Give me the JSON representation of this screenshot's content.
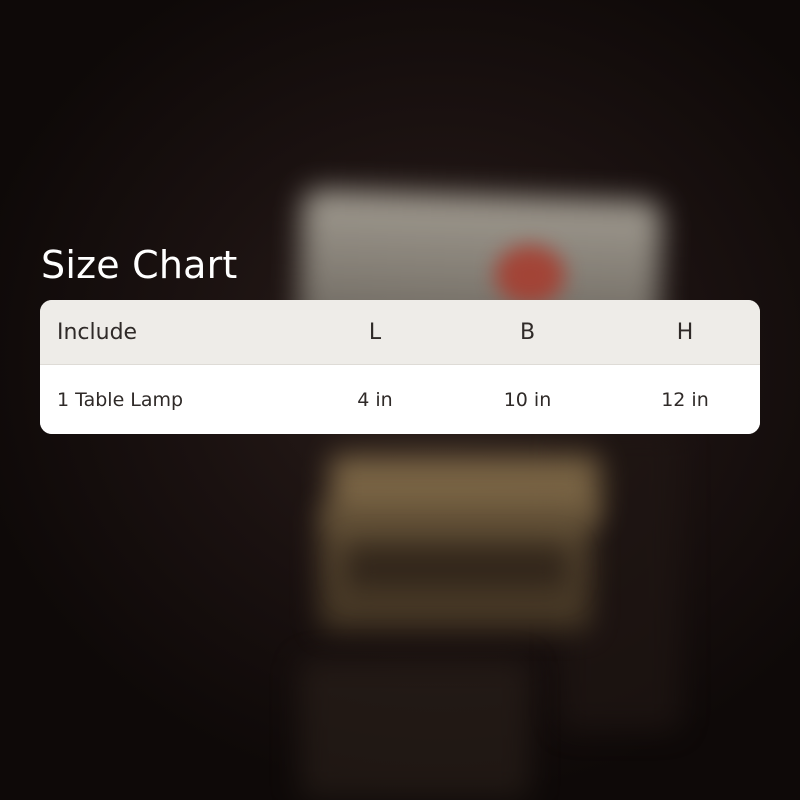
{
  "title": "Size Chart",
  "size_table": {
    "headers": [
      "Include",
      "L",
      "B",
      "H"
    ],
    "rows": [
      [
        "1 Table Lamp",
        "4 in",
        "10 in",
        "12 in"
      ]
    ]
  },
  "colors": {
    "background": "#120b0a",
    "header_bg": "#eeece8",
    "row_bg": "#ffffff",
    "text": "#2f2a28",
    "title": "#ffffff"
  }
}
